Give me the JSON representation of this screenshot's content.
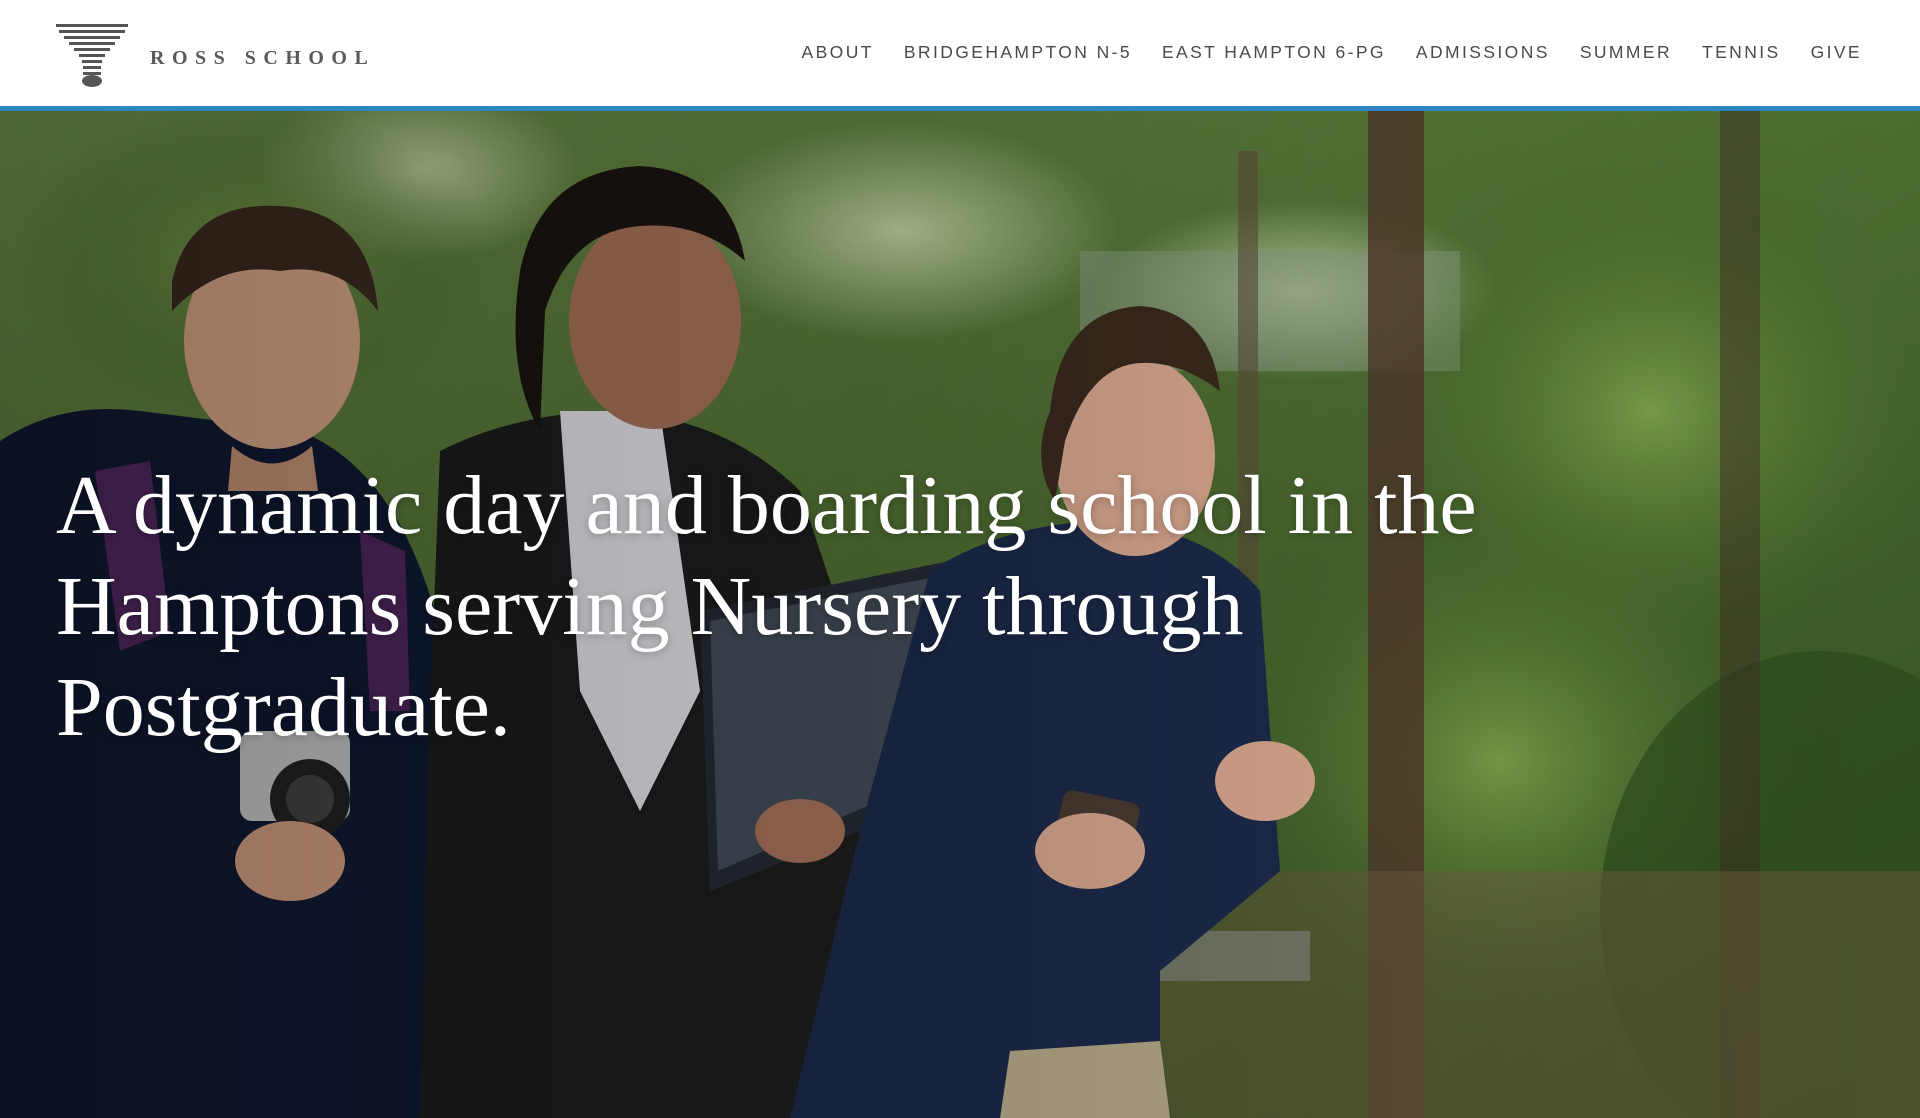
{
  "header": {
    "logo_text": "ROSS SCHOOL",
    "logo_icon": "ross-school-logo-mark",
    "nav": [
      {
        "label": "ABOUT"
      },
      {
        "label": "BRIDGEHAMPTON N-5"
      },
      {
        "label": "EAST HAMPTON 6-PG"
      },
      {
        "label": "ADMISSIONS"
      },
      {
        "label": "SUMMER"
      },
      {
        "label": "TENNIS"
      },
      {
        "label": "GIVE"
      }
    ]
  },
  "hero": {
    "headline": "A dynamic day and boarding school in the Hamptons serving Nursery through Postgraduate.",
    "image_alt": "Three smiling students walking outdoors among trees"
  },
  "colors": {
    "accent": "#2e86c1",
    "nav_text": "#4a4a4a",
    "logo_text": "#5a5a5a",
    "headline_text": "#ffffff"
  }
}
